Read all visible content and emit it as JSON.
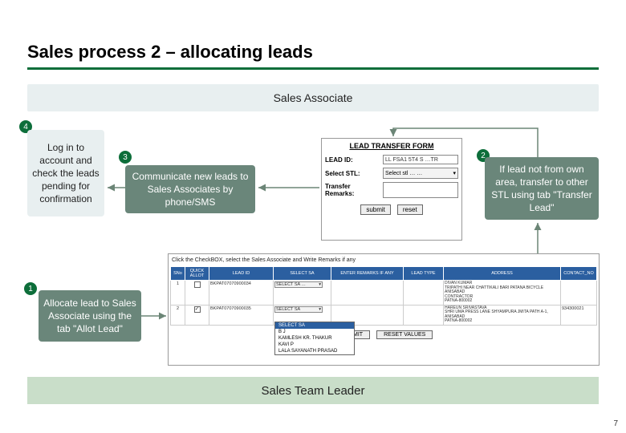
{
  "title": "Sales process 2 – allocating leads",
  "swimlanes": {
    "top": "Sales Associate",
    "bottom": "Sales Team Leader"
  },
  "steps": {
    "s4": {
      "num": "4",
      "text": "Log in to account and check the leads pending for confirmation"
    },
    "s3": {
      "num": "3",
      "text": "Communicate new leads to Sales Associates by phone/SMS"
    },
    "s2": {
      "num": "2",
      "text": "If lead not from own area, transfer to other STL using tab \"Transfer Lead\""
    },
    "s1": {
      "num": "1",
      "text": "Allocate lead to Sales Associate using the tab \"Allot Lead\""
    }
  },
  "transfer_form": {
    "header": "LEAD TRANSFER FORM",
    "lead_id_label": "LEAD ID:",
    "lead_id_value": "LL FSA1 5T4 S …TR",
    "select_stl_label": "Select STL:",
    "select_stl_value": "Select stl … …",
    "remarks_label": "Transfer Remarks:",
    "submit": "submit",
    "reset": "reset"
  },
  "allot_grid": {
    "instruction": "Click the CheckBOX, select the Sales Associate and Write Remarks if any",
    "headers": [
      "SNo",
      "QUICK ALLOT",
      "LEAD ID",
      "SELECT SA",
      "ENTER REMARKS IF ANY",
      "LEAD TYPE",
      "ADDRESS",
      "CONTACT_NO"
    ],
    "rows": [
      {
        "sno": "1",
        "checked": false,
        "lead_id": "BKPAT07070900034",
        "select_sa": "SELECT SA …",
        "remarks": "",
        "lead_type": "",
        "address": "DIVAN KUMAR\nTRIPATHI NEAR CHATTIKALI BARI PATANA BICYCLE\nANISABAD\nCONTRACTOR\nPATNA-800002",
        "contact": ""
      },
      {
        "sno": "2",
        "checked": true,
        "lead_id": "BKPAT07070900035",
        "select_sa": "SELECT SA",
        "remarks": "",
        "lead_type": "",
        "address": "HAREUN SRIVASTAVA\nSHRI UMA PRESS LANE SHYAMPURA JMITA PATH A-1,\nANISABAD\nPATNA-800002",
        "contact": "934300021"
      }
    ],
    "dropdown_options": [
      "SELECT SA",
      "B J ",
      "KAMLESH KR. THAKUR",
      "KAVI P",
      "LALA SAYANATH PRASAD"
    ],
    "submit": "SUBMIT",
    "reset": "RESET VALUES"
  },
  "page_number": "7"
}
